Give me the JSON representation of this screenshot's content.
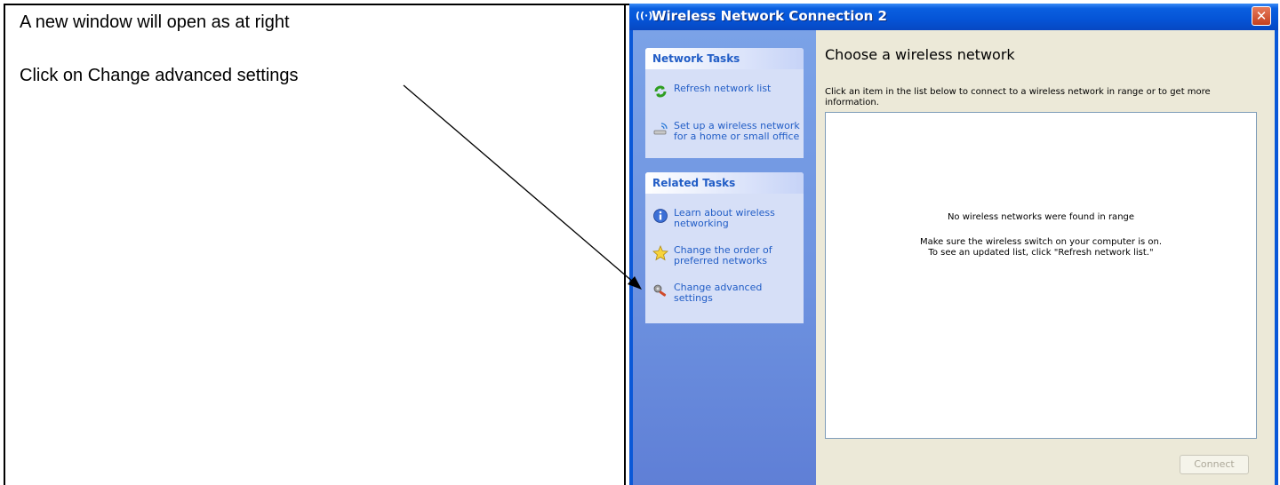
{
  "instructions": {
    "line1": "A new window will open as at right",
    "line2": "Click on Change advanced settings"
  },
  "window": {
    "title": "Wireless Network Connection 2",
    "title_icon": "((·))",
    "close_glyph": "✕"
  },
  "sidebar": {
    "network_tasks": {
      "header": "Network Tasks",
      "items": [
        {
          "label": "Refresh network list",
          "icon": "refresh-icon"
        },
        {
          "label": "Set up a wireless network\nfor a home or small office",
          "icon": "wireless-setup-icon"
        }
      ]
    },
    "related_tasks": {
      "header": "Related Tasks",
      "items": [
        {
          "label": "Learn about wireless\nnetworking",
          "icon": "info-icon"
        },
        {
          "label": "Change the order of\npreferred networks",
          "icon": "star-icon"
        },
        {
          "label": "Change advanced\nsettings",
          "icon": "settings-icon"
        }
      ]
    }
  },
  "main": {
    "heading": "Choose a wireless network",
    "description": "Click an item in the list below to connect to a wireless network in range or to get more information.",
    "empty_title": "No wireless networks were found in range",
    "empty_hint_1": "Make sure the wireless switch on your computer is on.",
    "empty_hint_2": "To see an updated list, click \"Refresh network list.\"",
    "connect_label": "Connect"
  },
  "colors": {
    "titlebar": "#0554d6",
    "sidebar": "#6e93e0",
    "task_link": "#215dc6",
    "client_bg": "#ece9d8"
  }
}
